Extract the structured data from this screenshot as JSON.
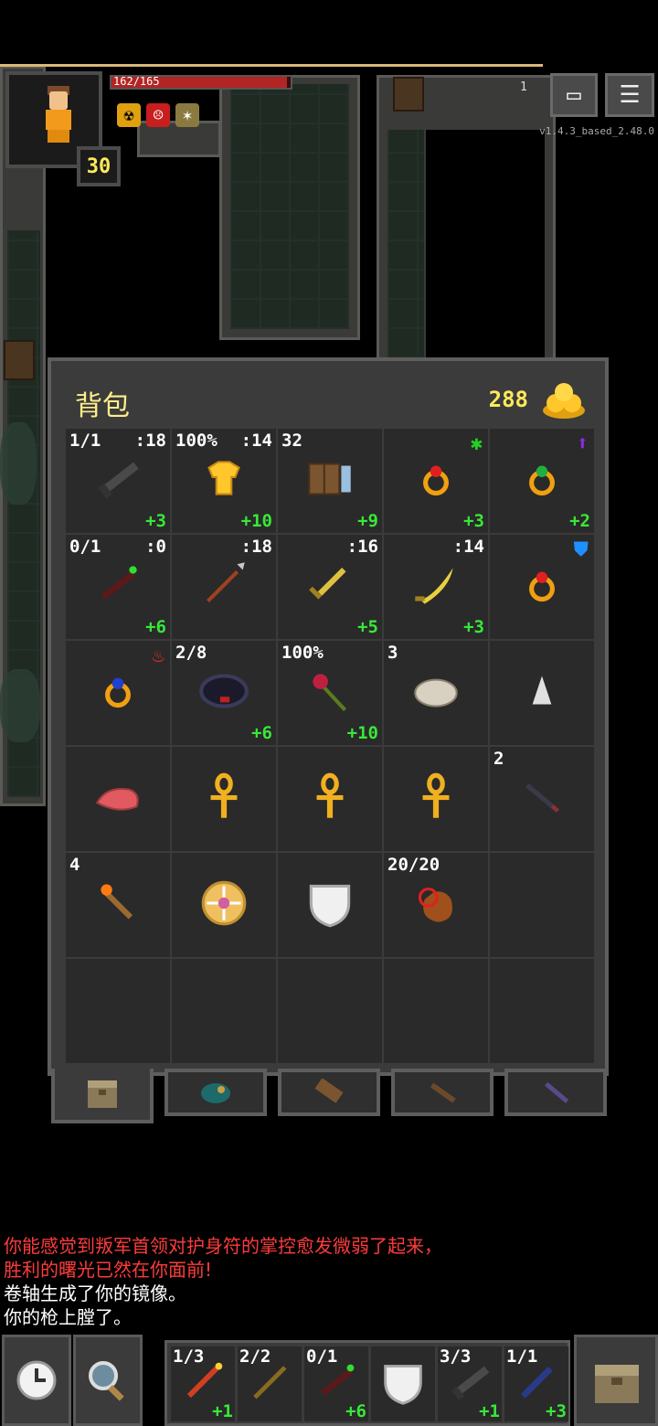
{
  "hud": {
    "hp_text": "162/165",
    "hp_fraction": 0.98,
    "level": "30",
    "depth": "1",
    "version": "v1.4.3_based_2.48.0",
    "buffs": [
      "radiation-icon",
      "rage-face-icon",
      "hunger-icon"
    ],
    "buttons": [
      "journal-icon",
      "menu-icon"
    ]
  },
  "bag": {
    "title": "背包",
    "gold": "288",
    "rows": [
      [
        {
          "icon": "gun-icon",
          "tl": "1/1",
          "tr": ":18",
          "br": "+3"
        },
        {
          "icon": "armor-icon",
          "tl": "100%",
          "tr": ":14",
          "br": "+10"
        },
        {
          "icon": "spellbook-icon",
          "tl": "32",
          "tr": "",
          "br": "+9"
        },
        {
          "icon": "ring-red-gem-icon",
          "tl": "",
          "tr": "",
          "br": "+3",
          "mark": "✱",
          "mark_color": "#21d321"
        },
        {
          "icon": "ring-green-gem-icon",
          "tl": "",
          "tr": "",
          "br": "+2",
          "mark": "⬆",
          "mark_color": "#8a2be2"
        }
      ],
      [
        {
          "icon": "wand-icon",
          "tl": "0/1",
          "tr": ":0",
          "br": "+6"
        },
        {
          "icon": "spear-icon",
          "tl": "",
          "tr": ":18",
          "br": ""
        },
        {
          "icon": "sword-icon",
          "tl": "",
          "tr": ":16",
          "br": "+5"
        },
        {
          "icon": "scimitar-icon",
          "tl": "",
          "tr": ":14",
          "br": "+3"
        },
        {
          "icon": "ring-red-gem-icon",
          "tl": "",
          "tr": "",
          "br": "",
          "mark": "⛊",
          "mark_color": "#1e90ff"
        }
      ],
      [
        {
          "icon": "ring-blue-gem-icon",
          "tl": "",
          "tr": "",
          "br": "",
          "mark": "♨",
          "mark_color": "#ff2a2a"
        },
        {
          "icon": "belt-icon",
          "tl": "2/8",
          "tr": "",
          "br": "+6"
        },
        {
          "icon": "rose-icon",
          "tl": "100%",
          "tr": "",
          "br": "+10"
        },
        {
          "icon": "stone-icon",
          "tl": "3",
          "tr": "",
          "br": ""
        },
        {
          "icon": "dust-icon",
          "tl": "",
          "tr": "",
          "br": ""
        }
      ],
      [
        {
          "icon": "meat-icon",
          "tl": "",
          "tr": "",
          "br": ""
        },
        {
          "icon": "ankh-icon",
          "tl": "",
          "tr": "",
          "br": ""
        },
        {
          "icon": "ankh-icon",
          "tl": "",
          "tr": "",
          "br": ""
        },
        {
          "icon": "ankh-icon",
          "tl": "",
          "tr": "",
          "br": ""
        },
        {
          "icon": "dart-icon",
          "tl": "2",
          "tr": "",
          "br": ""
        }
      ],
      [
        {
          "icon": "torch-icon",
          "tl": "4",
          "tr": "",
          "br": ""
        },
        {
          "icon": "amulet-icon",
          "tl": "",
          "tr": "",
          "br": ""
        },
        {
          "icon": "shield-icon",
          "tl": "",
          "tr": "",
          "br": ""
        },
        {
          "icon": "waterskin-icon",
          "tl": "20/20",
          "tr": "",
          "br": ""
        },
        {
          "icon": "",
          "tl": "",
          "tr": "",
          "br": ""
        }
      ],
      [
        {
          "icon": "",
          "tl": "",
          "tr": "",
          "br": ""
        },
        {
          "icon": "",
          "tl": "",
          "tr": "",
          "br": ""
        },
        {
          "icon": "",
          "tl": "",
          "tr": "",
          "br": ""
        },
        {
          "icon": "",
          "tl": "",
          "tr": "",
          "br": ""
        },
        {
          "icon": "",
          "tl": "",
          "tr": "",
          "br": ""
        }
      ]
    ],
    "tabs": [
      "backpack-icon",
      "seed-pouch-icon",
      "scroll-holder-icon",
      "wand-holster-icon",
      "potion-bandolier-icon"
    ]
  },
  "log": [
    {
      "text": "你能感觉到叛军首领对护身符的掌控愈发微弱了起来，",
      "color": "red"
    },
    {
      "text": "胜利的曙光已然在你面前!",
      "color": "red"
    },
    {
      "text": "卷轴生成了你的镜像。",
      "color": "white"
    },
    {
      "text": "你的枪上膛了。",
      "color": "white"
    }
  ],
  "toolbar": {
    "left_buttons": [
      "wait-clock-icon",
      "search-magnifier-icon"
    ],
    "quickslots": [
      {
        "icon": "fire-wand-icon",
        "tl": "1/3",
        "br": "+1"
      },
      {
        "icon": "staff-icon",
        "tl": "2/2",
        "br": ""
      },
      {
        "icon": "wand-icon",
        "tl": "0/1",
        "br": "+6"
      },
      {
        "icon": "shield-icon",
        "tl": "",
        "br": ""
      },
      {
        "icon": "gun-icon",
        "tl": "3/3",
        "br": "+1"
      },
      {
        "icon": "blue-wand-icon",
        "tl": "1/1",
        "br": "+3"
      }
    ],
    "inventory_button": "backpack-icon"
  }
}
